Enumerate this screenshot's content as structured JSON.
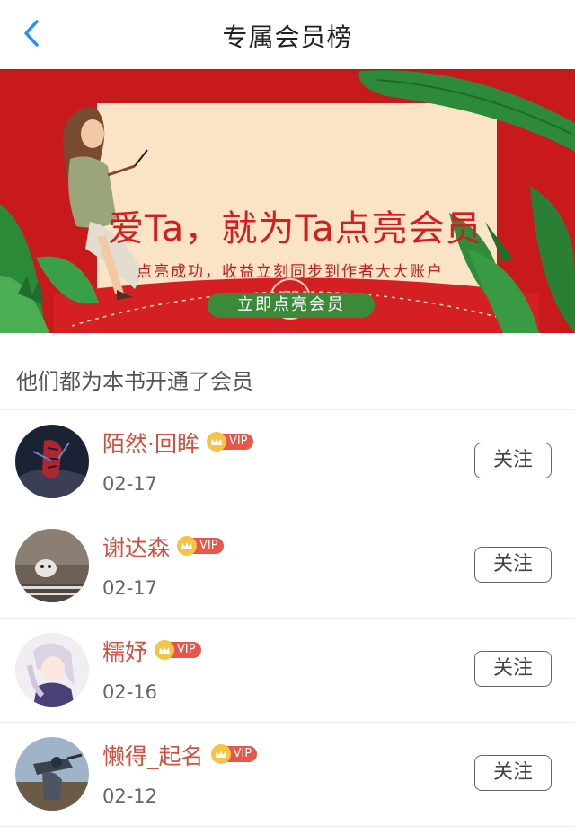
{
  "header": {
    "title": "专属会员榜",
    "back_icon": "chevron-left-icon",
    "back_color": "#1e90ff"
  },
  "banner": {
    "title": "爱Ta，就为Ta点亮会员",
    "subtitle": "点亮成功，收益立刻同步到作者大大账户",
    "cta": "立即点亮会员",
    "bg_color": "#c8191c",
    "card_color": "#fbe3c6",
    "button_color": "#3a8a3a"
  },
  "section": {
    "title": "他们都为本书开通了会员"
  },
  "members": [
    {
      "name": "陌然·回眸",
      "badge": "VIP",
      "date": "02-17",
      "follow": "关注"
    },
    {
      "name": "谢达森",
      "badge": "VIP",
      "date": "02-17",
      "follow": "关注"
    },
    {
      "name": "糯妤",
      "badge": "VIP",
      "date": "02-16",
      "follow": "关注"
    },
    {
      "name": "懒得_起名",
      "badge": "VIP",
      "date": "02-12",
      "follow": "关注"
    }
  ],
  "colors": {
    "name": "#d34f3d",
    "vip_tag": "#e9554b",
    "crown": "#f4c542"
  }
}
